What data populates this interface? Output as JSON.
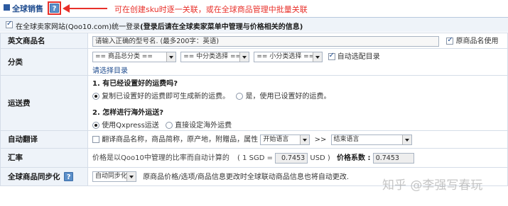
{
  "header": {
    "title": "全球销售",
    "help_glyph": "?",
    "annotation": "可在创建sku时逐一关联，或在全球商品管理中批量关联",
    "annotation_color": "#e8302a"
  },
  "subheader": {
    "checkbox_checked": true,
    "text": "在全球卖家网站(Qoo10.com)统一登录",
    "bold_text": "(登录后请在全球卖家菜单中管理与价格相关的信息)"
  },
  "rows": {
    "english_name": {
      "label": "英文商品名",
      "placeholder": "请输入正确的型号名. (最多200字：英语)",
      "use_original_label": "原商品名使用",
      "use_original_checked": true
    },
    "category": {
      "label": "分类",
      "select1": "== 商品总分类 ==",
      "select2": "== 中分类选择 ==",
      "select3": "== 小分类选择 ==",
      "auto_select_label": "自动选配目录",
      "auto_select_checked": true,
      "link": "请选择目录"
    },
    "shipping": {
      "label": "运送费",
      "q1": "1. 有已经设置好的运费吗?",
      "q1_opt1": "复制已设置好的运费即可生成新的运费。",
      "q1_opt2": "是，使用已设置好的运费。",
      "q2": "2. 怎样进行海外运送?",
      "q2_opt1": "使用Qxpress运送",
      "q2_opt2": "直接设定海外运费"
    },
    "translate": {
      "label": "自动翻译",
      "checkbox_label": "翻译商品名称，商品简称，原产地，附赠品，属性",
      "start_lang": "开始语言",
      "arrow": ">>",
      "end_lang": "结束语言"
    },
    "exchange": {
      "label": "汇率",
      "text": "价格是以Qoo10中管理的比率而自动计算的",
      "rate_prefix": "( 1 SGD =",
      "rate_value": "0.7453",
      "rate_suffix": "USD )",
      "coef_label": "价格系数 :",
      "coef_value": "0.7453"
    },
    "sync": {
      "label": "全球商品同步化",
      "select": "自动同步化",
      "note": "原商品价格/选项/商品信息更改时全球联动商品信息也将自动更改."
    }
  },
  "watermark": "知乎 @李强写春玩",
  "colors": {
    "label_bg": "#eef3f9",
    "accent": "#1f4c8f",
    "border": "#d5dde8"
  }
}
